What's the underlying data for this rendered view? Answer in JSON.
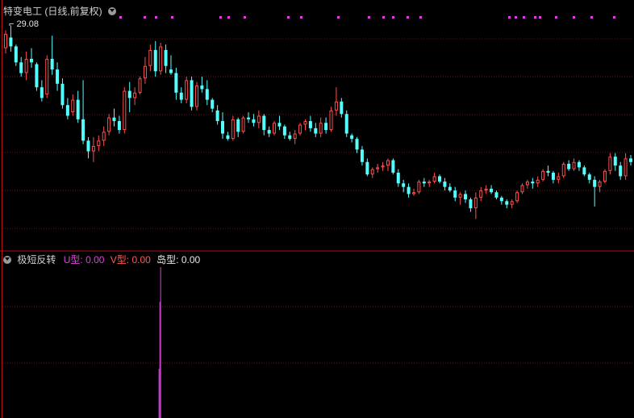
{
  "main_pane": {
    "title": "特变电工 (日线,前复权)",
    "max_label": "29.08",
    "colors": {
      "up": "#ff4f4f",
      "down": "#54ffff",
      "grid": "#7a1010",
      "marker": "#e040e0"
    }
  },
  "indicator_pane": {
    "title": "极短反转",
    "items": [
      {
        "label": "U型:",
        "value": "0.00"
      },
      {
        "label": "V型:",
        "value": "0.00"
      },
      {
        "label": "岛型:",
        "value": "0.00"
      }
    ],
    "colors": {
      "u": "#e040e0",
      "v": "#ff5a5a",
      "island": "#e8e8e8"
    }
  },
  "chart_data": [
    {
      "type": "candlestick",
      "title": "特变电工 (日线,前复权)",
      "max_annotation": 29.08,
      "y_range": [
        16.4,
        29.6
      ],
      "candles": [
        [
          27.8,
          28.8,
          27.5,
          28.6
        ],
        [
          28.4,
          29.08,
          27.6,
          27.9
        ],
        [
          27.9,
          28.0,
          26.8,
          27.0
        ],
        [
          27.0,
          27.3,
          26.2,
          26.4
        ],
        [
          26.4,
          27.6,
          26.0,
          27.2
        ],
        [
          27.2,
          27.8,
          26.7,
          27.0
        ],
        [
          26.9,
          27.0,
          25.4,
          25.6
        ],
        [
          25.6,
          26.0,
          24.8,
          25.0
        ],
        [
          25.2,
          27.4,
          25.0,
          27.2
        ],
        [
          27.2,
          28.5,
          26.3,
          26.6
        ],
        [
          26.6,
          27.0,
          25.4,
          25.8
        ],
        [
          25.8,
          26.1,
          24.4,
          24.6
        ],
        [
          24.6,
          25.0,
          23.8,
          24.0
        ],
        [
          24.2,
          25.2,
          24.0,
          24.9
        ],
        [
          24.9,
          25.4,
          23.6,
          23.8
        ],
        [
          23.8,
          26.0,
          22.4,
          22.6
        ],
        [
          22.6,
          22.8,
          21.6,
          22.0
        ],
        [
          22.0,
          22.8,
          21.4,
          22.3
        ],
        [
          22.3,
          22.9,
          22.0,
          22.6
        ],
        [
          22.6,
          23.4,
          22.3,
          23.1
        ],
        [
          23.1,
          24.1,
          22.9,
          23.9
        ],
        [
          23.9,
          24.4,
          23.4,
          23.7
        ],
        [
          23.7,
          24.0,
          23.0,
          23.2
        ],
        [
          23.2,
          25.6,
          23.0,
          25.4
        ],
        [
          25.4,
          25.9,
          24.2,
          25.0
        ],
        [
          25.0,
          25.6,
          24.6,
          25.3
        ],
        [
          25.3,
          26.2,
          25.2,
          26.1
        ],
        [
          26.1,
          27.3,
          25.8,
          26.8
        ],
        [
          26.8,
          28.0,
          26.5,
          27.7
        ],
        [
          27.7,
          28.2,
          26.2,
          26.5
        ],
        [
          26.5,
          28.1,
          26.3,
          27.9
        ],
        [
          27.7,
          28.0,
          26.4,
          26.8
        ],
        [
          26.6,
          27.4,
          26.3,
          26.4
        ],
        [
          26.4,
          26.7,
          24.9,
          25.3
        ],
        [
          25.3,
          25.6,
          24.7,
          24.9
        ],
        [
          24.9,
          26.2,
          24.7,
          26.0
        ],
        [
          26.0,
          26.2,
          24.3,
          24.5
        ],
        [
          24.5,
          25.9,
          24.3,
          25.7
        ],
        [
          25.7,
          26.2,
          25.3,
          25.5
        ],
        [
          25.5,
          26.0,
          24.6,
          24.9
        ],
        [
          24.9,
          25.0,
          24.2,
          24.4
        ],
        [
          24.3,
          24.6,
          23.5,
          23.7
        ],
        [
          23.7,
          24.2,
          22.7,
          23.0
        ],
        [
          22.9,
          23.1,
          22.6,
          22.7
        ],
        [
          22.7,
          24.0,
          22.6,
          23.8
        ],
        [
          23.8,
          23.9,
          22.8,
          23.1
        ],
        [
          23.1,
          24.0,
          23.0,
          23.9
        ],
        [
          23.9,
          24.2,
          23.6,
          23.8
        ],
        [
          23.8,
          24.1,
          23.4,
          23.6
        ],
        [
          23.6,
          24.3,
          23.3,
          24.0
        ],
        [
          24.0,
          24.1,
          22.9,
          23.2
        ],
        [
          23.2,
          23.4,
          22.8,
          23.0
        ],
        [
          23.0,
          23.7,
          22.9,
          23.6
        ],
        [
          23.6,
          24.0,
          23.2,
          23.4
        ],
        [
          23.4,
          23.5,
          22.7,
          22.9
        ],
        [
          22.9,
          23.1,
          22.6,
          22.7
        ],
        [
          22.7,
          23.2,
          22.4,
          23.0
        ],
        [
          23.0,
          23.6,
          22.9,
          23.5
        ],
        [
          23.5,
          23.8,
          23.2,
          23.7
        ],
        [
          23.7,
          24.0,
          23.1,
          23.3
        ],
        [
          23.3,
          23.6,
          22.8,
          23.0
        ],
        [
          23.0,
          23.9,
          22.8,
          23.6
        ],
        [
          23.6,
          23.9,
          23.0,
          23.2
        ],
        [
          23.2,
          24.5,
          23.1,
          24.3
        ],
        [
          24.3,
          25.6,
          24.0,
          24.8
        ],
        [
          24.8,
          25.0,
          23.9,
          24.1
        ],
        [
          24.1,
          24.3,
          22.8,
          23.0
        ],
        [
          22.9,
          23.0,
          22.5,
          22.7
        ],
        [
          22.7,
          22.8,
          21.9,
          22.1
        ],
        [
          22.1,
          22.3,
          21.2,
          21.4
        ],
        [
          21.4,
          21.6,
          20.6,
          20.7
        ],
        [
          20.7,
          21.1,
          20.5,
          21.0
        ],
        [
          21.0,
          21.3,
          20.8,
          21.1
        ],
        [
          21.1,
          21.4,
          20.9,
          21.2
        ],
        [
          21.2,
          21.6,
          20.9,
          21.5
        ],
        [
          21.5,
          21.6,
          20.7,
          20.8
        ],
        [
          20.8,
          21.0,
          20.0,
          20.2
        ],
        [
          20.2,
          20.4,
          19.7,
          20.0
        ],
        [
          20.0,
          20.2,
          19.4,
          19.6
        ],
        [
          19.6,
          19.9,
          19.5,
          19.7
        ],
        [
          19.7,
          20.4,
          19.6,
          20.3
        ],
        [
          20.3,
          20.5,
          20.0,
          20.2
        ],
        [
          20.2,
          20.4,
          20.0,
          20.3
        ],
        [
          20.3,
          20.8,
          20.2,
          20.6
        ],
        [
          20.6,
          20.7,
          20.2,
          20.3
        ],
        [
          20.3,
          20.5,
          19.8,
          20.0
        ],
        [
          20.0,
          20.2,
          19.7,
          19.8
        ],
        [
          19.8,
          20.0,
          19.2,
          19.4
        ],
        [
          19.4,
          19.7,
          19.0,
          19.6
        ],
        [
          19.6,
          19.8,
          19.1,
          19.3
        ],
        [
          19.3,
          19.4,
          18.6,
          18.8
        ],
        [
          18.8,
          19.7,
          18.2,
          19.4
        ],
        [
          19.4,
          20.0,
          19.2,
          19.8
        ],
        [
          19.8,
          20.1,
          19.6,
          19.9
        ],
        [
          19.9,
          20.1,
          19.6,
          19.7
        ],
        [
          19.7,
          19.8,
          19.3,
          19.4
        ],
        [
          19.4,
          19.5,
          19.0,
          19.2
        ],
        [
          19.2,
          19.3,
          18.8,
          19.0
        ],
        [
          19.0,
          19.3,
          18.8,
          19.2
        ],
        [
          19.2,
          19.8,
          19.1,
          19.7
        ],
        [
          19.7,
          20.2,
          19.6,
          20.1
        ],
        [
          20.1,
          20.4,
          19.9,
          20.3
        ],
        [
          20.3,
          20.5,
          19.9,
          20.2
        ],
        [
          20.2,
          20.6,
          20.0,
          20.4
        ],
        [
          20.4,
          21.0,
          20.3,
          20.9
        ],
        [
          20.9,
          21.2,
          20.6,
          20.8
        ],
        [
          20.8,
          20.9,
          20.2,
          20.4
        ],
        [
          20.4,
          20.8,
          20.2,
          20.6
        ],
        [
          20.6,
          21.4,
          20.5,
          21.3
        ],
        [
          21.3,
          21.5,
          20.9,
          21.0
        ],
        [
          21.0,
          21.6,
          20.9,
          21.4
        ],
        [
          21.4,
          21.5,
          20.9,
          21.1
        ],
        [
          21.1,
          21.2,
          20.6,
          20.7
        ],
        [
          20.7,
          20.8,
          20.2,
          20.4
        ],
        [
          20.4,
          20.6,
          18.9,
          20.0
        ],
        [
          20.0,
          20.4,
          19.7,
          20.3
        ],
        [
          20.3,
          21.0,
          20.2,
          20.9
        ],
        [
          20.9,
          21.9,
          20.7,
          21.7
        ],
        [
          21.7,
          21.9,
          20.9,
          21.2
        ],
        [
          21.2,
          21.4,
          20.4,
          20.6
        ],
        [
          20.6,
          21.9,
          20.4,
          21.6
        ],
        [
          21.6,
          21.8,
          21.2,
          21.4
        ]
      ],
      "signal_dots_x": [
        148,
        178,
        192,
        212,
        272,
        282,
        302,
        356,
        372,
        418,
        456,
        474,
        486,
        504,
        520,
        630,
        638,
        648,
        662,
        668,
        688,
        710,
        732,
        760
      ]
    },
    {
      "type": "bar",
      "title": "极短反转",
      "series": [
        {
          "name": "U型",
          "value": 0.0
        },
        {
          "name": "V型",
          "value": 0.0
        },
        {
          "name": "岛型",
          "value": 0.0
        }
      ],
      "spike_at_bar": 30
    }
  ]
}
